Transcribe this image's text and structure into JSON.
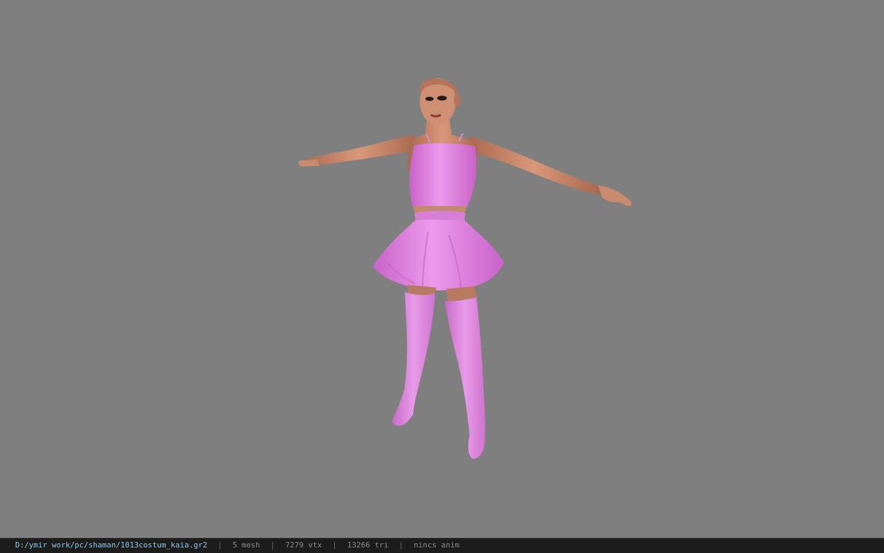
{
  "viewport": {
    "background": "#7f7f7f",
    "model_description_icon": "character-model-icon"
  },
  "statusbar": {
    "file_path": "D:/ymir work/pc/shaman/1013costum_kaia.gr2",
    "separator": "|",
    "mesh_count": "5 mesh",
    "vertex_count": "7279 vtx",
    "triangle_count": "13266 tri",
    "anim_status": "nincs anim"
  },
  "colors": {
    "statusbar_bg": "#1c1c1c",
    "path_text": "#8fc7e6",
    "stat_text": "#8a8a8a",
    "costume_pink": "#e07fe0",
    "skin": "#c8866a"
  }
}
